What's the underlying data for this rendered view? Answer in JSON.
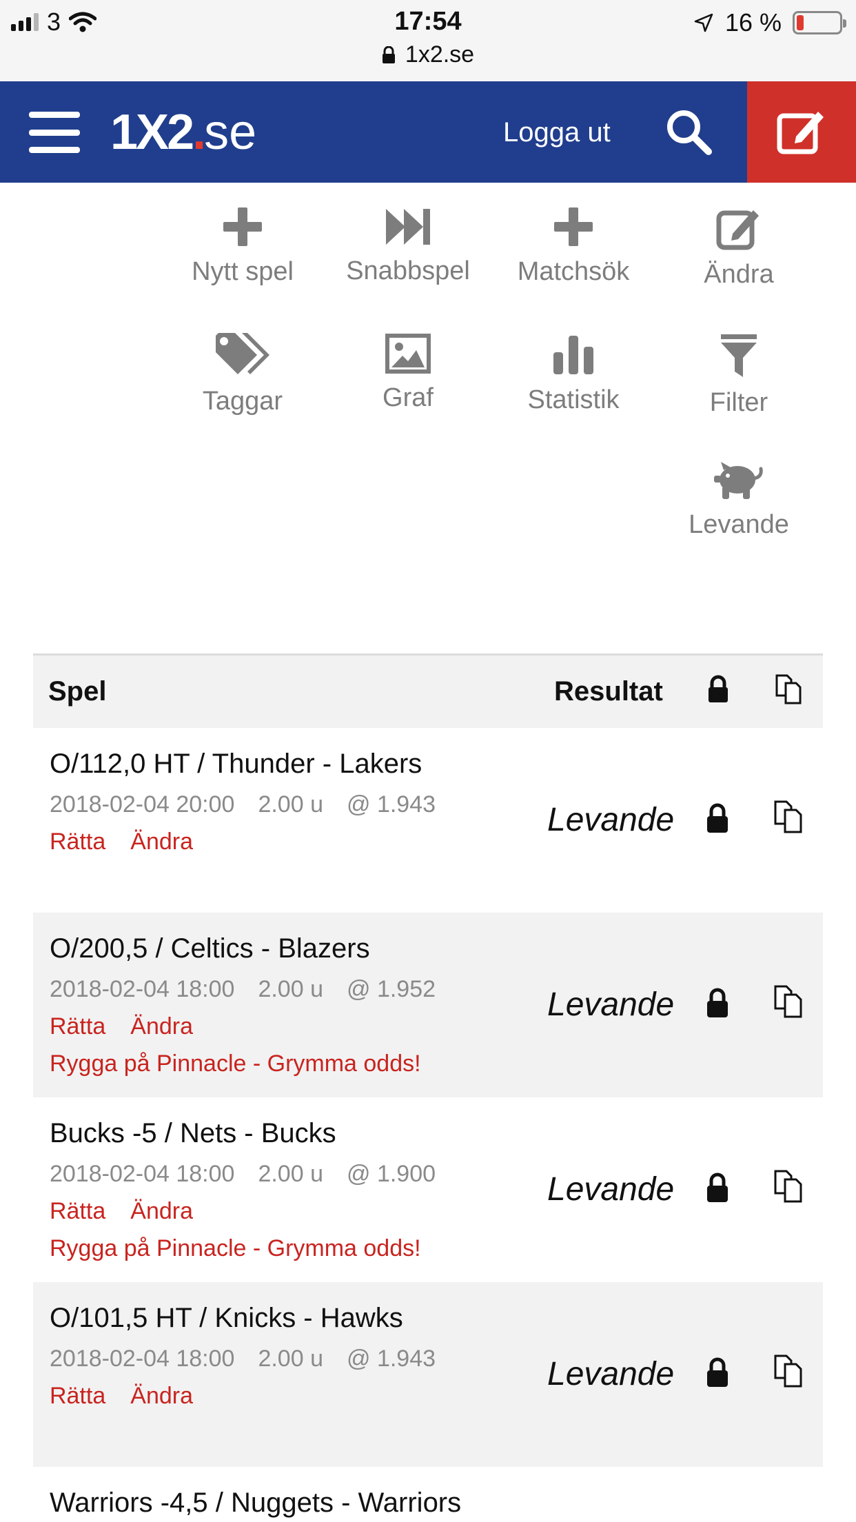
{
  "status_bar": {
    "carrier": "3",
    "time": "17:54",
    "url": "1x2.se",
    "battery_text": "16 %",
    "battery_level": 0.16,
    "battery_color": "#e03a2e"
  },
  "nav": {
    "logo_main": "1X2",
    "logo_dot": ".",
    "logo_tld": "se",
    "logout_label": "Logga ut",
    "bg_color": "#203e8d",
    "accent_color": "#d0302a"
  },
  "actions": [
    {
      "label": "Nytt spel",
      "icon": "plus-icon"
    },
    {
      "label": "Snabbspel",
      "icon": "fast-forward-icon"
    },
    {
      "label": "Matchsök",
      "icon": "plus-icon"
    },
    {
      "label": "Ändra",
      "icon": "edit-icon"
    },
    {
      "label": "Taggar",
      "icon": "tags-icon"
    },
    {
      "label": "Graf",
      "icon": "image-icon"
    },
    {
      "label": "Statistik",
      "icon": "bar-chart-icon"
    },
    {
      "label": "Filter",
      "icon": "filter-icon"
    },
    {
      "label": "Levande",
      "icon": "piggy-bank-icon"
    }
  ],
  "table": {
    "headers": {
      "game": "Spel",
      "result": "Resultat"
    },
    "rows": [
      {
        "title": "O/112,0 HT / Thunder - Lakers",
        "datetime": "2018-02-04 20:00",
        "stake": "2.00 u",
        "odds": "@ 1.943",
        "link_correct": "Rätta",
        "link_edit": "Ändra",
        "warning": "",
        "result": "Levande"
      },
      {
        "title": "O/200,5 / Celtics - Blazers",
        "datetime": "2018-02-04 18:00",
        "stake": "2.00 u",
        "odds": "@ 1.952",
        "link_correct": "Rätta",
        "link_edit": "Ändra",
        "warning": "Rygga på Pinnacle - Grymma odds!",
        "result": "Levande"
      },
      {
        "title": "Bucks -5 / Nets - Bucks",
        "datetime": "2018-02-04 18:00",
        "stake": "2.00 u",
        "odds": "@ 1.900",
        "link_correct": "Rätta",
        "link_edit": "Ändra",
        "warning": "Rygga på Pinnacle - Grymma odds!",
        "result": "Levande"
      },
      {
        "title": "O/101,5 HT / Knicks - Hawks",
        "datetime": "2018-02-04 18:00",
        "stake": "2.00 u",
        "odds": "@ 1.943",
        "link_correct": "Rätta",
        "link_edit": "Ändra",
        "warning": "",
        "result": "Levande"
      }
    ],
    "partial_row_title": "Warriors -4,5 / Nuggets - Warriors"
  }
}
